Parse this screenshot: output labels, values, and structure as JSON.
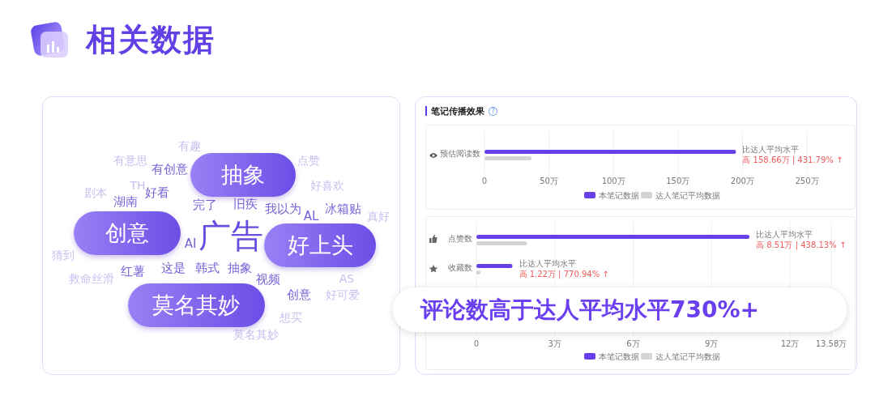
{
  "header": {
    "title": "相关数据"
  },
  "word_cloud": {
    "words": [
      {
        "text": "有趣",
        "kind": "faint"
      },
      {
        "text": "有意思",
        "kind": "faint"
      },
      {
        "text": "有创意",
        "kind": "strong"
      },
      {
        "text": "点赞",
        "kind": "faint"
      },
      {
        "text": "剧本",
        "kind": "faint"
      },
      {
        "text": "TH",
        "kind": "faint"
      },
      {
        "text": "好看",
        "kind": "strong"
      },
      {
        "text": "好喜欢",
        "kind": "faint"
      },
      {
        "text": "湖南",
        "kind": "strong"
      },
      {
        "text": "完了",
        "kind": "strong"
      },
      {
        "text": "旧疾",
        "kind": "strong"
      },
      {
        "text": "我以为",
        "kind": "strong"
      },
      {
        "text": "冰箱贴",
        "kind": "strong"
      },
      {
        "text": "AL",
        "kind": "strong"
      },
      {
        "text": "真好",
        "kind": "faint"
      },
      {
        "text": "AI",
        "kind": "strong"
      },
      {
        "text": "广告",
        "kind": "big"
      },
      {
        "text": "猜到",
        "kind": "faint"
      },
      {
        "text": "红薯",
        "kind": "strong"
      },
      {
        "text": "这是",
        "kind": "strong"
      },
      {
        "text": "韩式",
        "kind": "strong"
      },
      {
        "text": "抽象",
        "kind": "strong"
      },
      {
        "text": "救命丝滑",
        "kind": "faint"
      },
      {
        "text": "视频",
        "kind": "strong"
      },
      {
        "text": "AS",
        "kind": "faint"
      },
      {
        "text": "创意",
        "kind": "strong"
      },
      {
        "text": "好可爱",
        "kind": "faint"
      },
      {
        "text": "想买",
        "kind": "faint"
      },
      {
        "text": "莫名其妙",
        "kind": "faint"
      }
    ],
    "highlights": [
      "抽象",
      "创意",
      "好上头",
      "莫名其妙"
    ]
  },
  "spread": {
    "title": "笔记传播效果",
    "help": "?",
    "panels": [
      {
        "comparisons": [
          {
            "note": "比达人平均水平",
            "diff": "高 158.66万 | 431.79%",
            "arrow": "↑"
          }
        ],
        "chart_data": {
          "type": "bar",
          "orientation": "horizontal",
          "categories": [
            "预估阅读数"
          ],
          "series": [
            {
              "name": "本笔记数据",
              "color": "#6540e8",
              "values": [
                195
              ]
            },
            {
              "name": "达人笔记平均数据",
              "color": "#d4d4d4",
              "values": [
                36.4
              ]
            }
          ],
          "grid": true,
          "legend": "bottom",
          "xlim": [
            0,
            250
          ],
          "xticks": [
            {
              "value": 0,
              "label": "0"
            },
            {
              "value": 50,
              "label": "50万"
            },
            {
              "value": 100,
              "label": "100万"
            },
            {
              "value": 150,
              "label": "150万"
            },
            {
              "value": 200,
              "label": "200万"
            },
            {
              "value": 250,
              "label": "250万"
            }
          ]
        }
      },
      {
        "comparisons": [
          {
            "note": "比达人平均水平",
            "diff": "高 8.51万 | 438.13%",
            "arrow": "↑"
          },
          {
            "note": "比达人平均水平",
            "diff": "高 1.22万 | 770.94%",
            "arrow": "↑"
          }
        ],
        "chart_data": {
          "type": "bar",
          "orientation": "horizontal",
          "categories": [
            "点赞数",
            "收藏数"
          ],
          "series": [
            {
              "name": "本笔记数据",
              "color": "#6540e8",
              "values": [
                10.45,
                1.38
              ]
            },
            {
              "name": "达人笔记平均数据",
              "color": "#d4d4d4",
              "values": [
                1.94,
                0.16
              ]
            }
          ],
          "grid": true,
          "legend": "bottom",
          "xlim": [
            0,
            13.58
          ],
          "xticks": [
            {
              "value": 0,
              "label": "0"
            },
            {
              "value": 3,
              "label": "3万"
            },
            {
              "value": 6,
              "label": "6万"
            },
            {
              "value": 9,
              "label": "9万"
            },
            {
              "value": 12,
              "label": "12万"
            },
            {
              "value": 13.58,
              "label": "13.58万"
            }
          ]
        }
      }
    ]
  },
  "callout": {
    "text": "评论数高于达人平均水平730%+"
  }
}
